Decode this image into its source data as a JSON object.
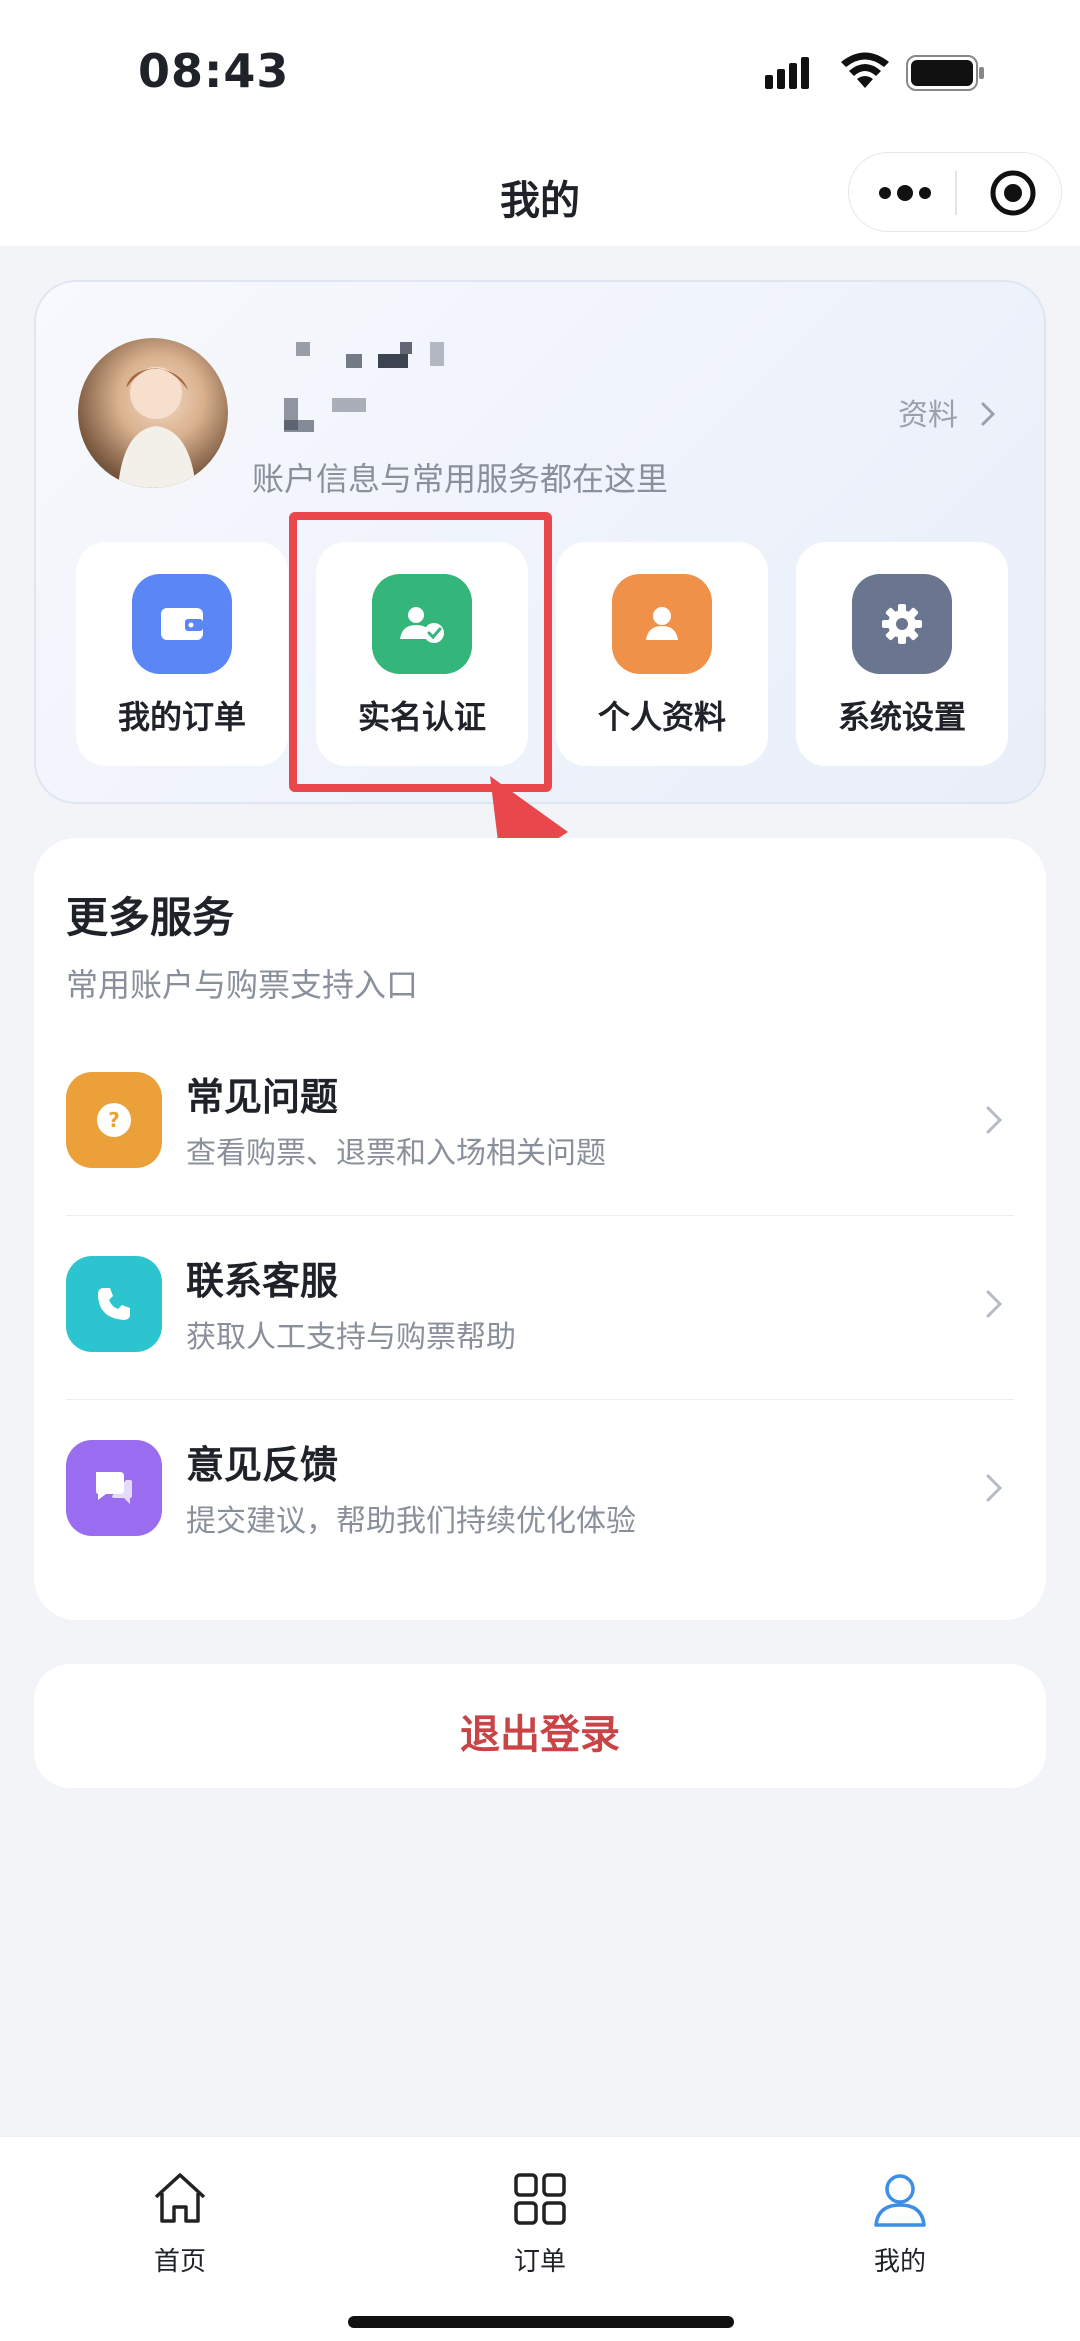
{
  "status_bar": {
    "time": "08:43"
  },
  "nav": {
    "title": "我的"
  },
  "profile": {
    "link_label": "资料",
    "subtitle": "账户信息与常用服务都在这里",
    "quick_actions": [
      {
        "label": "我的订单",
        "icon": "wallet-icon",
        "color": "#5b86f5"
      },
      {
        "label": "实名认证",
        "icon": "verified-user-icon",
        "color": "#34b57a"
      },
      {
        "label": "个人资料",
        "icon": "person-icon",
        "color": "#f0914a"
      },
      {
        "label": "系统设置",
        "icon": "gear-icon",
        "color": "#6a7590"
      }
    ]
  },
  "more_services": {
    "title": "更多服务",
    "subtitle": "常用账户与购票支持入口",
    "items": [
      {
        "title": "常见问题",
        "subtitle": "查看购票、退票和入场相关问题",
        "icon": "question-icon",
        "color": "#eba03a"
      },
      {
        "title": "联系客服",
        "subtitle": "获取人工支持与购票帮助",
        "icon": "phone-icon",
        "color": "#2bc4cf"
      },
      {
        "title": "意见反馈",
        "subtitle": "提交建议，帮助我们持续优化体验",
        "icon": "chat-bubbles-icon",
        "color": "#9a6cf0"
      }
    ]
  },
  "logout": {
    "label": "退出登录"
  },
  "tabbar": {
    "items": [
      {
        "label": "首页",
        "icon": "home-icon"
      },
      {
        "label": "订单",
        "icon": "grid-icon"
      },
      {
        "label": "我的",
        "icon": "user-icon",
        "active": true
      }
    ]
  }
}
